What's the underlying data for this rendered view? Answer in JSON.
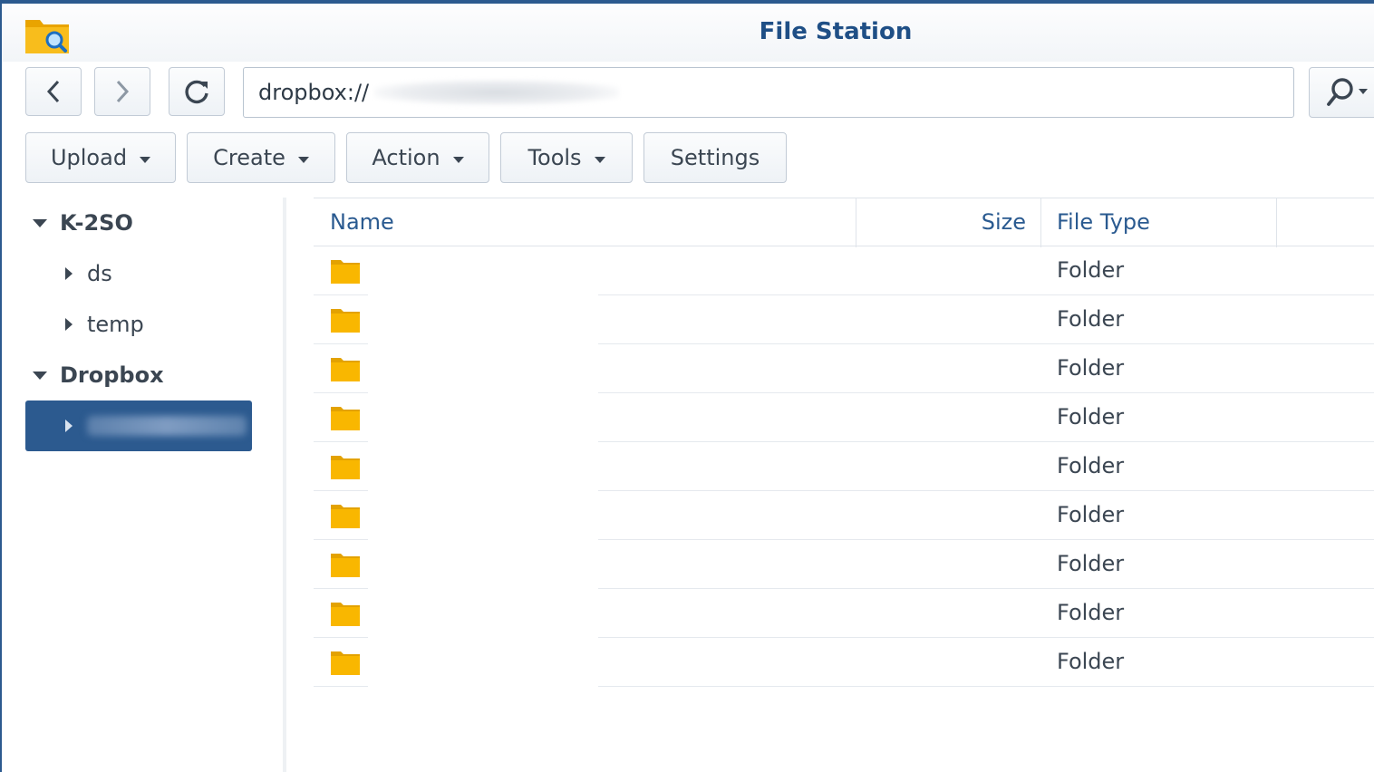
{
  "window": {
    "title": "File Station"
  },
  "toolbar": {
    "back_icon": "chevron-left-icon",
    "forward_icon": "chevron-right-icon",
    "refresh_icon": "refresh-icon",
    "address_value": "dropbox://",
    "search_icon": "search-icon",
    "buttons": [
      {
        "label": "Upload"
      },
      {
        "label": "Create"
      },
      {
        "label": "Action"
      },
      {
        "label": "Tools"
      },
      {
        "label": "Settings"
      }
    ]
  },
  "sidebar": {
    "nodes": [
      {
        "label": "K-2SO"
      },
      {
        "label": "ds"
      },
      {
        "label": "temp"
      },
      {
        "label": "Dropbox"
      }
    ]
  },
  "grid": {
    "columns": {
      "name": "Name",
      "size": "Size",
      "type": "File Type"
    },
    "rows": [
      {
        "type": "Folder"
      },
      {
        "type": "Folder"
      },
      {
        "type": "Folder"
      },
      {
        "type": "Folder"
      },
      {
        "type": "Folder"
      },
      {
        "type": "Folder"
      },
      {
        "type": "Folder"
      },
      {
        "type": "Folder"
      },
      {
        "type": "Folder"
      }
    ]
  },
  "colors": {
    "accent": "#2c5a8f",
    "title": "#1f4f86",
    "header_text": "#2a5a90",
    "folder": "#f9b700"
  }
}
